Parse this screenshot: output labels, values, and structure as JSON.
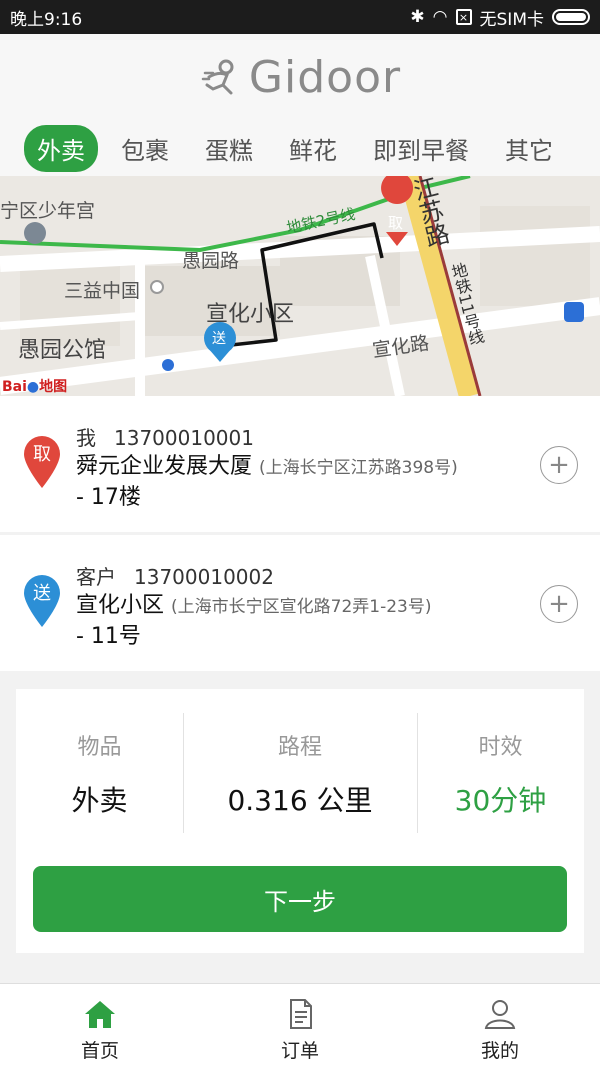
{
  "status_bar": {
    "time": "晚上9:16",
    "carrier": "无SIM卡"
  },
  "header": {
    "logo_text": "Gidoor"
  },
  "tabs": [
    {
      "label": "外卖",
      "active": true
    },
    {
      "label": "包裹",
      "active": false
    },
    {
      "label": "蛋糕",
      "active": false
    },
    {
      "label": "鲜花",
      "active": false
    },
    {
      "label": "即到早餐",
      "active": false
    },
    {
      "label": "其它",
      "active": false
    }
  ],
  "map": {
    "labels": {
      "youth_palace": "宁区少年宫",
      "yuyuan_road": "愚园路",
      "metro2": "地铁2号线",
      "jiangsu_road": "江苏路",
      "sanyi": "三益中国",
      "xuanhua_xiaoqu": "宣化小区",
      "yuyuan_guan": "愚园公馆",
      "xuanhua_road": "宣化路",
      "metro11": "地铁11号线",
      "baidu": "Bai",
      "baidu_map": "地图"
    },
    "pickup_marker": "取",
    "dropoff_marker": "送"
  },
  "pickup": {
    "marker": "取",
    "name": "我",
    "phone": "13700010001",
    "place": "舜元企业发展大厦",
    "address": "(上海长宁区江苏路398号)",
    "floor": "- 17楼"
  },
  "dropoff": {
    "marker": "送",
    "name": "客户",
    "phone": "13700010002",
    "place": "宣化小区",
    "address": "(上海市长宁区宣化路72弄1-23号)",
    "floor": "- 11号"
  },
  "summary": {
    "item_label": "物品",
    "item_value": "外卖",
    "distance_label": "路程",
    "distance_value": "0.316  公里",
    "time_label": "时效",
    "time_value": "30分钟",
    "next_button": "下一步"
  },
  "bottom_nav": [
    {
      "label": "首页",
      "icon": "home-icon",
      "active": true
    },
    {
      "label": "订单",
      "icon": "document-icon",
      "active": false
    },
    {
      "label": "我的",
      "icon": "user-icon",
      "active": false
    }
  ],
  "colors": {
    "accent": "#2ea043",
    "pickup": "#e0473c",
    "dropoff": "#2c8fd6"
  }
}
